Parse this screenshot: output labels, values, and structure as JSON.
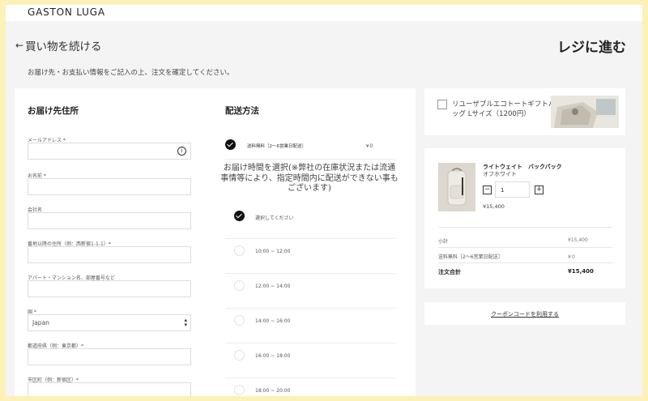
{
  "header": {
    "brand": "GASTON LUGA",
    "back_label": "買い物を続ける",
    "checkout_title": "レジに進む",
    "subtitle": "お届け先・お支払い情報をご記入の上、注文を確定してください。"
  },
  "address": {
    "title": "お届け先住所",
    "fields": [
      {
        "label": "メールアドレス *",
        "value": ""
      },
      {
        "label": "お名前 *",
        "value": ""
      },
      {
        "label": "会社名",
        "value": ""
      },
      {
        "label": "番地以降の住所（例：西新宿1-1-1）*",
        "value": ""
      },
      {
        "label": "アパート・マンション名、部屋番号など",
        "value": ""
      },
      {
        "label": "国 *",
        "value": "Japan"
      },
      {
        "label": "都道府県（例：東京都）*",
        "value": ""
      },
      {
        "label": "市区町（例：新宿区）*",
        "value": ""
      }
    ]
  },
  "shipping": {
    "title": "配送方法",
    "method": {
      "label": "送料無料［2〜6営業日配送］",
      "price": "¥０"
    },
    "time_note": "お届け時間を選択(※弊社の在庫状況または流通事情等により、指定時間内に配送ができない事もございます)",
    "slots": [
      "選択してください",
      "10:00 ~ 12:00",
      "12:00 ~ 14:00",
      "14:00 ~ 16:00",
      "16:00 ~ 18:00",
      "18:00 ~ 20:00"
    ]
  },
  "gift": {
    "label": "リユーザブルエコトートギフトバッグ Lサイズ（1200円）"
  },
  "cart": {
    "product_name": "ライトウェイト　バックパック",
    "product_color": "オフホワイト",
    "quantity": "1",
    "minus": "−",
    "plus": "+",
    "price": "¥15,400"
  },
  "summary": {
    "subtotal_label": "小計",
    "subtotal_value": "¥15,400",
    "shipping_label": "送料無料［2〜6営業日配送］",
    "shipping_value": "¥０",
    "total_label": "注文合計",
    "total_value": "¥15,400"
  },
  "coupon": {
    "label": "クーポンコードを利用する"
  },
  "icons": {
    "back": "arrow-left-icon",
    "info": "info-icon",
    "select": "select-arrows-icon",
    "checked": "check-radio-icon"
  }
}
